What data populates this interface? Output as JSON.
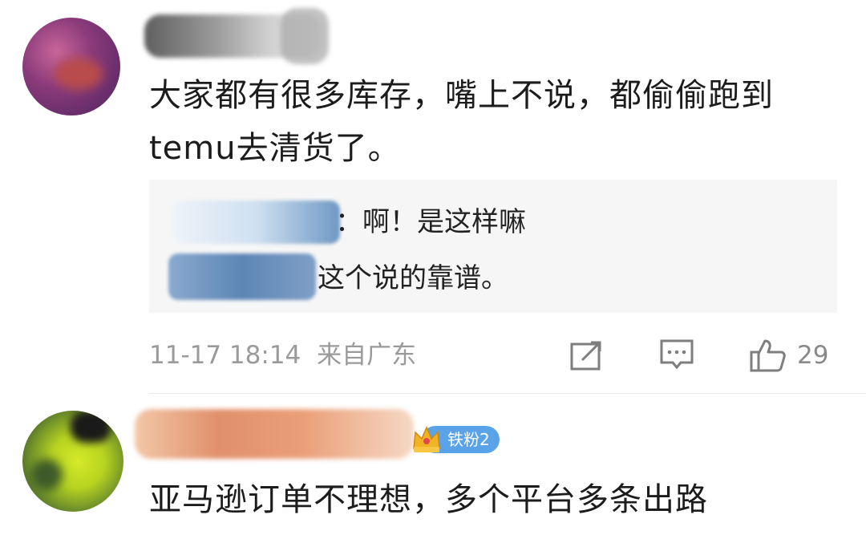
{
  "comments": [
    {
      "text": "大家都有很多库存，嘴上不说，都偷偷跑到temu去清货了。",
      "replies": [
        {
          "text": "：啊！是这样嘛"
        },
        {
          "text": "这个说的靠谱。"
        }
      ],
      "timestamp": "11-17 18:14",
      "location": "来自广东",
      "likes": "29"
    },
    {
      "badge": "铁粉2",
      "text": "亚马逊订单不理想，多个平台多条出路"
    }
  ],
  "icons": {
    "share": "share-icon",
    "comment": "comment-icon",
    "like": "thumbs-up-icon",
    "badge": "crown-icon"
  },
  "colors": {
    "badge_blue": "#5aa3e8",
    "reply_bg": "#f6f6f6",
    "meta_gray": "#9a9a9a"
  }
}
